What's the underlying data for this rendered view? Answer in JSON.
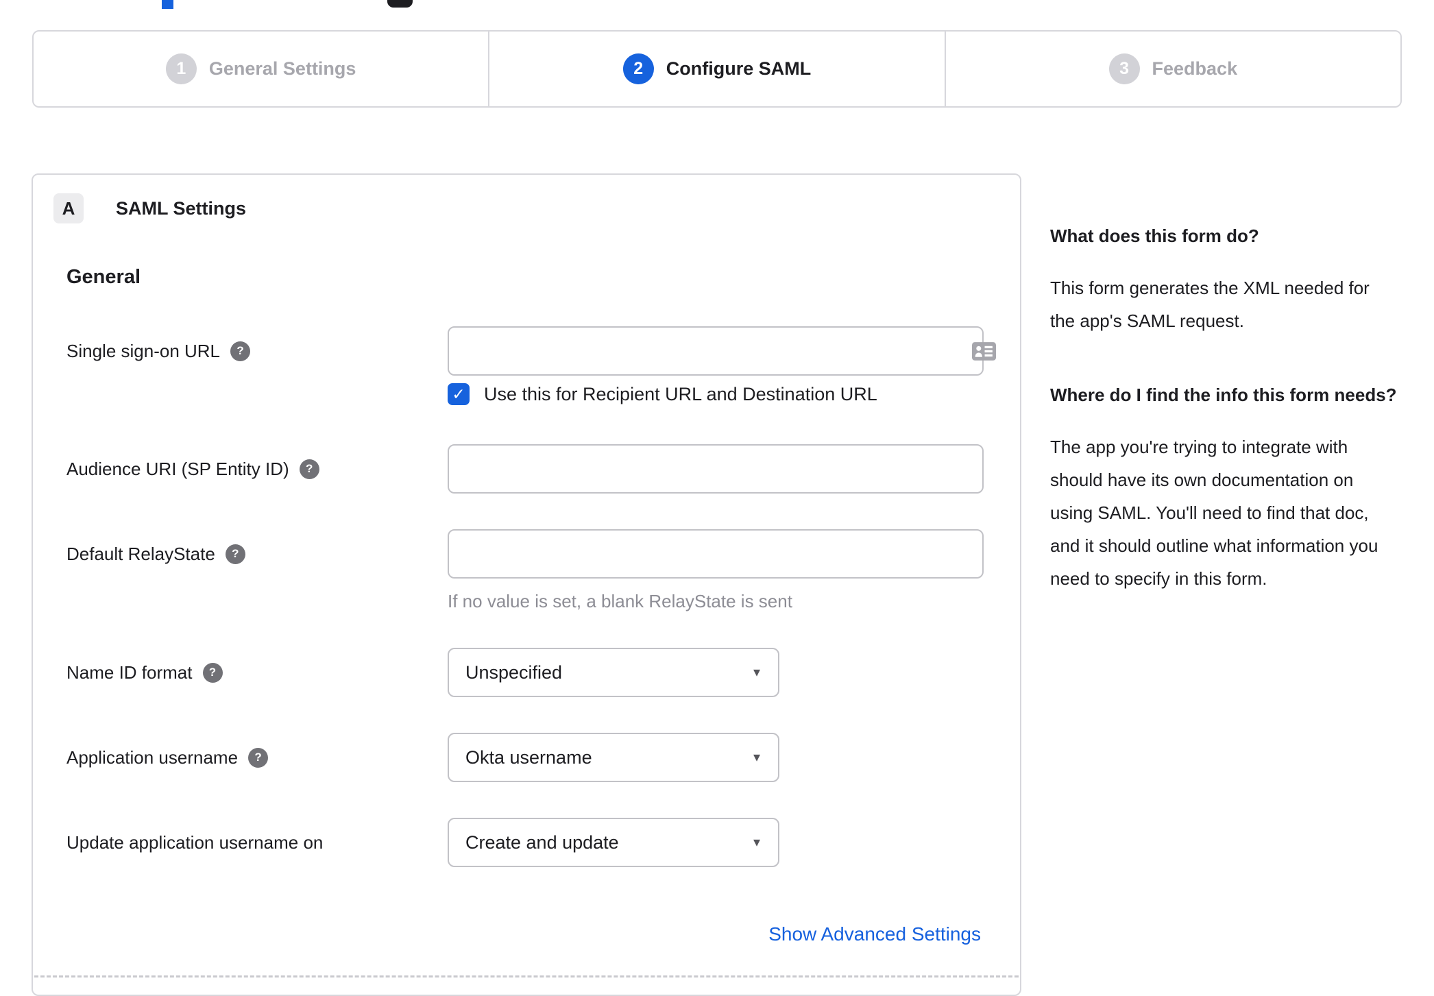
{
  "stepper": {
    "steps": [
      {
        "number": "1",
        "label": "General Settings",
        "active": false
      },
      {
        "number": "2",
        "label": "Configure SAML",
        "active": true
      },
      {
        "number": "3",
        "label": "Feedback",
        "active": false
      }
    ]
  },
  "panel": {
    "section_badge": "A",
    "title": "SAML Settings",
    "group_heading": "General",
    "fields": {
      "sso_url": {
        "label": "Single sign-on URL",
        "value": "",
        "checkbox_label": "Use this for Recipient URL and Destination URL",
        "checkbox_checked": true
      },
      "audience_uri": {
        "label": "Audience URI (SP Entity ID)",
        "value": ""
      },
      "default_relay_state": {
        "label": "Default RelayState",
        "value": "",
        "helper": "If no value is set, a blank RelayState is sent"
      },
      "name_id_format": {
        "label": "Name ID format",
        "value": "Unspecified"
      },
      "application_username": {
        "label": "Application username",
        "value": "Okta username"
      },
      "update_application_username_on": {
        "label": "Update application username on",
        "value": "Create and update"
      }
    },
    "advanced_link": "Show Advanced Settings"
  },
  "sidebar": {
    "heading_1": "What does this form do?",
    "para_1": "This form generates the XML needed for the app's SAML request.",
    "heading_2": "Where do I find the info this form needs?",
    "para_2": "The app you're trying to integrate with should have its own documentation on using SAML. You'll need to find that doc, and it should outline what information you need to specify in this form."
  },
  "icons": {
    "help_glyph": "?",
    "check_glyph": "✓",
    "dropdown_glyph": "▾"
  },
  "colors": {
    "accent_blue": "#1662dd",
    "link_blue": "#1661de",
    "border_gray": "#d7d7dc",
    "inactive_gray": "#a7a7ad"
  }
}
